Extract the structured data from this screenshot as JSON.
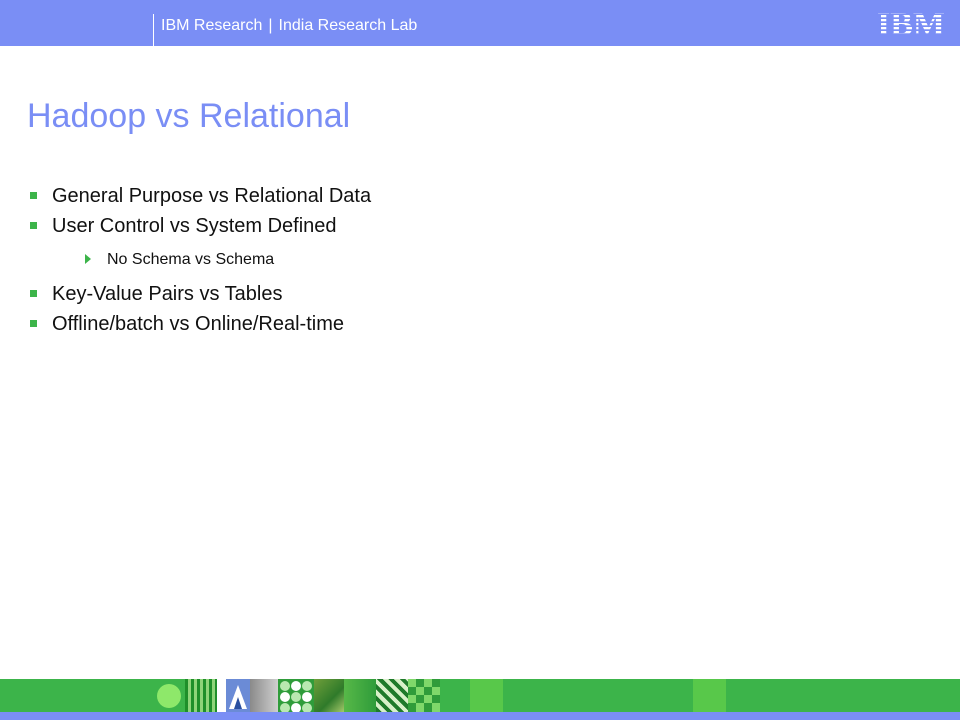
{
  "header": {
    "org": "IBM Research",
    "separator": "|",
    "lab": "India Research Lab",
    "logo_text": "IBM"
  },
  "slide": {
    "title": "Hadoop vs Relational",
    "bullets": [
      {
        "text": "General Purpose vs Relational Data"
      },
      {
        "text": "User Control vs System Defined",
        "sub": [
          "No Schema vs Schema"
        ]
      },
      {
        "text": "Key-Value Pairs vs Tables"
      },
      {
        "text": "Offline/batch vs Online/Real-time"
      }
    ]
  },
  "colors": {
    "header_bar": "#7a8ef5",
    "title": "#7a8ef5",
    "bullet_marker": "#3cb44a",
    "footer_green": "#3cb44a"
  },
  "icons": {
    "bullet": "square-bullet-icon",
    "sub_bullet": "triangle-bullet-icon",
    "logo": "ibm-logo-icon"
  }
}
